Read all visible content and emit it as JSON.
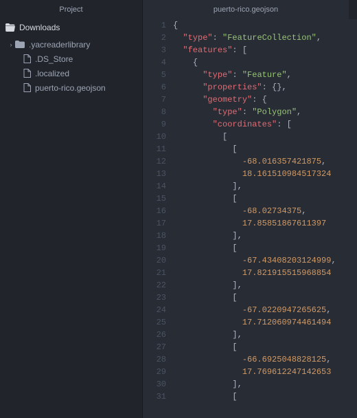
{
  "sidebar": {
    "header": "Project",
    "root": {
      "label": "Downloads",
      "icon": "folder-open-icon"
    },
    "items": [
      {
        "label": ".yacreaderlibrary",
        "icon": "folder-icon",
        "expandable": true
      },
      {
        "label": ".DS_Store",
        "icon": "file-icon",
        "expandable": false
      },
      {
        "label": ".localized",
        "icon": "file-icon",
        "expandable": false
      },
      {
        "label": "puerto-rico.geojson",
        "icon": "file-icon",
        "expandable": false
      }
    ]
  },
  "tab": {
    "title": "puerto-rico.geojson"
  },
  "code": {
    "lines": [
      [
        {
          "t": "punc",
          "v": "{"
        }
      ],
      [
        {
          "t": "indent",
          "v": "  "
        },
        {
          "t": "key",
          "v": "\"type\""
        },
        {
          "t": "punc",
          "v": ": "
        },
        {
          "t": "str",
          "v": "\"FeatureCollection\""
        },
        {
          "t": "punc",
          "v": ","
        }
      ],
      [
        {
          "t": "indent",
          "v": "  "
        },
        {
          "t": "key",
          "v": "\"features\""
        },
        {
          "t": "punc",
          "v": ": ["
        }
      ],
      [
        {
          "t": "indent",
          "v": "    "
        },
        {
          "t": "punc",
          "v": "{"
        }
      ],
      [
        {
          "t": "indent",
          "v": "      "
        },
        {
          "t": "key",
          "v": "\"type\""
        },
        {
          "t": "punc",
          "v": ": "
        },
        {
          "t": "str",
          "v": "\"Feature\""
        },
        {
          "t": "punc",
          "v": ","
        }
      ],
      [
        {
          "t": "indent",
          "v": "      "
        },
        {
          "t": "key",
          "v": "\"properties\""
        },
        {
          "t": "punc",
          "v": ": {},"
        }
      ],
      [
        {
          "t": "indent",
          "v": "      "
        },
        {
          "t": "key",
          "v": "\"geometry\""
        },
        {
          "t": "punc",
          "v": ": {"
        }
      ],
      [
        {
          "t": "indent",
          "v": "        "
        },
        {
          "t": "key",
          "v": "\"type\""
        },
        {
          "t": "punc",
          "v": ": "
        },
        {
          "t": "str",
          "v": "\"Polygon\""
        },
        {
          "t": "punc",
          "v": ","
        }
      ],
      [
        {
          "t": "indent",
          "v": "        "
        },
        {
          "t": "key",
          "v": "\"coordinates\""
        },
        {
          "t": "punc",
          "v": ": ["
        }
      ],
      [
        {
          "t": "indent",
          "v": "          "
        },
        {
          "t": "punc",
          "v": "["
        }
      ],
      [
        {
          "t": "indent",
          "v": "            "
        },
        {
          "t": "punc",
          "v": "["
        }
      ],
      [
        {
          "t": "indent",
          "v": "              "
        },
        {
          "t": "num",
          "v": "-68.016357421875"
        },
        {
          "t": "punc",
          "v": ","
        }
      ],
      [
        {
          "t": "indent",
          "v": "              "
        },
        {
          "t": "num",
          "v": "18.161510984517324"
        }
      ],
      [
        {
          "t": "indent",
          "v": "            "
        },
        {
          "t": "punc",
          "v": "],"
        }
      ],
      [
        {
          "t": "indent",
          "v": "            "
        },
        {
          "t": "punc",
          "v": "["
        }
      ],
      [
        {
          "t": "indent",
          "v": "              "
        },
        {
          "t": "num",
          "v": "-68.02734375"
        },
        {
          "t": "punc",
          "v": ","
        }
      ],
      [
        {
          "t": "indent",
          "v": "              "
        },
        {
          "t": "num",
          "v": "17.85851867611397"
        }
      ],
      [
        {
          "t": "indent",
          "v": "            "
        },
        {
          "t": "punc",
          "v": "],"
        }
      ],
      [
        {
          "t": "indent",
          "v": "            "
        },
        {
          "t": "punc",
          "v": "["
        }
      ],
      [
        {
          "t": "indent",
          "v": "              "
        },
        {
          "t": "num",
          "v": "-67.43408203124999"
        },
        {
          "t": "punc",
          "v": ","
        }
      ],
      [
        {
          "t": "indent",
          "v": "              "
        },
        {
          "t": "num",
          "v": "17.821915515968854"
        }
      ],
      [
        {
          "t": "indent",
          "v": "            "
        },
        {
          "t": "punc",
          "v": "],"
        }
      ],
      [
        {
          "t": "indent",
          "v": "            "
        },
        {
          "t": "punc",
          "v": "["
        }
      ],
      [
        {
          "t": "indent",
          "v": "              "
        },
        {
          "t": "num",
          "v": "-67.0220947265625"
        },
        {
          "t": "punc",
          "v": ","
        }
      ],
      [
        {
          "t": "indent",
          "v": "              "
        },
        {
          "t": "num",
          "v": "17.712060974461494"
        }
      ],
      [
        {
          "t": "indent",
          "v": "            "
        },
        {
          "t": "punc",
          "v": "],"
        }
      ],
      [
        {
          "t": "indent",
          "v": "            "
        },
        {
          "t": "punc",
          "v": "["
        }
      ],
      [
        {
          "t": "indent",
          "v": "              "
        },
        {
          "t": "num",
          "v": "-66.6925048828125"
        },
        {
          "t": "punc",
          "v": ","
        }
      ],
      [
        {
          "t": "indent",
          "v": "              "
        },
        {
          "t": "num",
          "v": "17.769612247142653"
        }
      ],
      [
        {
          "t": "indent",
          "v": "            "
        },
        {
          "t": "punc",
          "v": "],"
        }
      ],
      [
        {
          "t": "indent",
          "v": "            "
        },
        {
          "t": "punc",
          "v": "["
        }
      ]
    ]
  }
}
